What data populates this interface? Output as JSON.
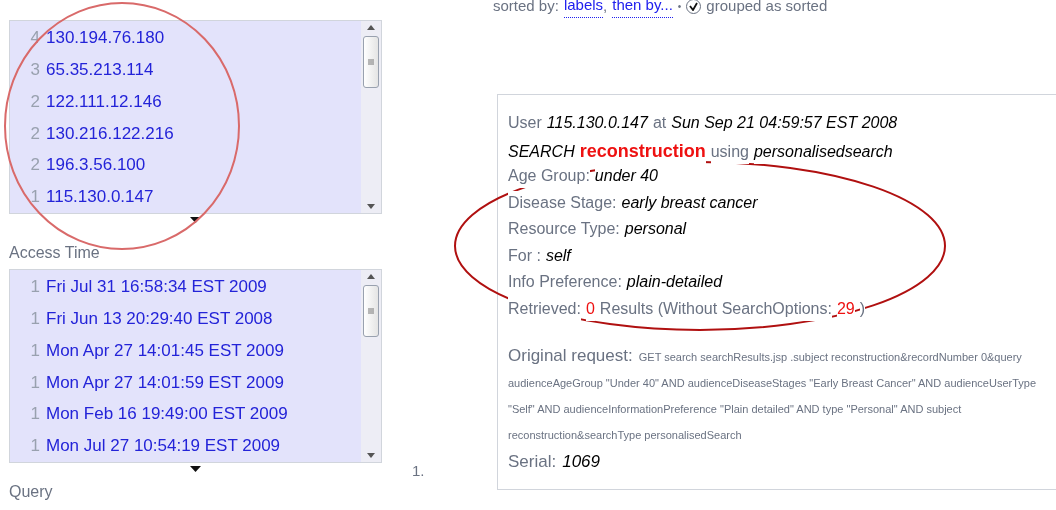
{
  "lists": [
    {
      "items": [
        {
          "count": "4",
          "label": "130.194.76.180"
        },
        {
          "count": "3",
          "label": "65.35.213.114"
        },
        {
          "count": "2",
          "label": "122.111.12.146"
        },
        {
          "count": "2",
          "label": "130.216.122.216"
        },
        {
          "count": "2",
          "label": "196.3.56.100"
        },
        {
          "count": "1",
          "label": "115.130.0.147"
        }
      ]
    },
    {
      "heading": "Access Time",
      "items": [
        {
          "count": "1",
          "label": "Fri Jul 31 16:58:34 EST 2009"
        },
        {
          "count": "1",
          "label": "Fri Jun 13 20:29:40 EST 2008"
        },
        {
          "count": "1",
          "label": "Mon Apr 27 14:01:45 EST 2009"
        },
        {
          "count": "1",
          "label": "Mon Apr 27 14:01:59 EST 2009"
        },
        {
          "count": "1",
          "label": "Mon Feb 16 19:49:00 EST 2009"
        },
        {
          "count": "1",
          "label": "Mon Jul 27 10:54:19 EST 2009"
        }
      ]
    }
  ],
  "next_heading": "Query",
  "sort_bar": {
    "prefix": "sorted by:",
    "links": [
      "labels",
      "then by..."
    ],
    "link_separator": ",",
    "separator": "•",
    "grouped": {
      "checked": true,
      "label": "grouped as sorted"
    }
  },
  "result": {
    "number": "1.",
    "lines": [
      [
        {
          "kind": "label",
          "text": "User"
        },
        {
          "kind": "value",
          "text": "115.130.0.147"
        },
        {
          "kind": "label",
          "text": "at"
        },
        {
          "kind": "value",
          "text": "Sun Sep 21 04:59:57 EST 2008"
        }
      ],
      [
        {
          "kind": "value",
          "text": "SEARCH"
        },
        {
          "kind": "highlight",
          "text": "reconstruction"
        },
        {
          "kind": "label",
          "text": "using"
        },
        {
          "kind": "value",
          "text": "personalisedsearch"
        }
      ],
      [
        {
          "kind": "label",
          "text": "Age Group:"
        },
        {
          "kind": "value",
          "text": "under 40"
        }
      ],
      [
        {
          "kind": "label",
          "text": "Disease Stage:"
        },
        {
          "kind": "value",
          "text": "early breast cancer"
        }
      ],
      [
        {
          "kind": "label",
          "text": "Resource Type:"
        },
        {
          "kind": "value",
          "text": "personal"
        }
      ],
      [
        {
          "kind": "label",
          "text": "For :"
        },
        {
          "kind": "value",
          "text": "self"
        }
      ],
      [
        {
          "kind": "label",
          "text": "Info Preference:"
        },
        {
          "kind": "value",
          "text": "plain-detailed"
        }
      ],
      [
        {
          "kind": "label",
          "text": "Retrieved:"
        },
        {
          "kind": "number",
          "text": "0"
        },
        {
          "kind": "label",
          "text": "Results (Without SearchOptions:"
        },
        {
          "kind": "number",
          "text": "29"
        },
        {
          "kind": "label",
          "text": ")"
        }
      ]
    ],
    "request_label": "Original request:",
    "request_text": "GET search searchResults.jsp .subject reconstruction&recordNumber 0&query audienceAgeGroup \"Under 40\" AND audienceDiseaseStages \"Early Breast Cancer\" AND audienceUserType \"Self\" AND audienceInformationPreference \"Plain detailed\" AND type \"Personal\" AND subject reconstruction&searchType personalisedSearch",
    "serial_label": "Serial:",
    "serial": "1069"
  }
}
